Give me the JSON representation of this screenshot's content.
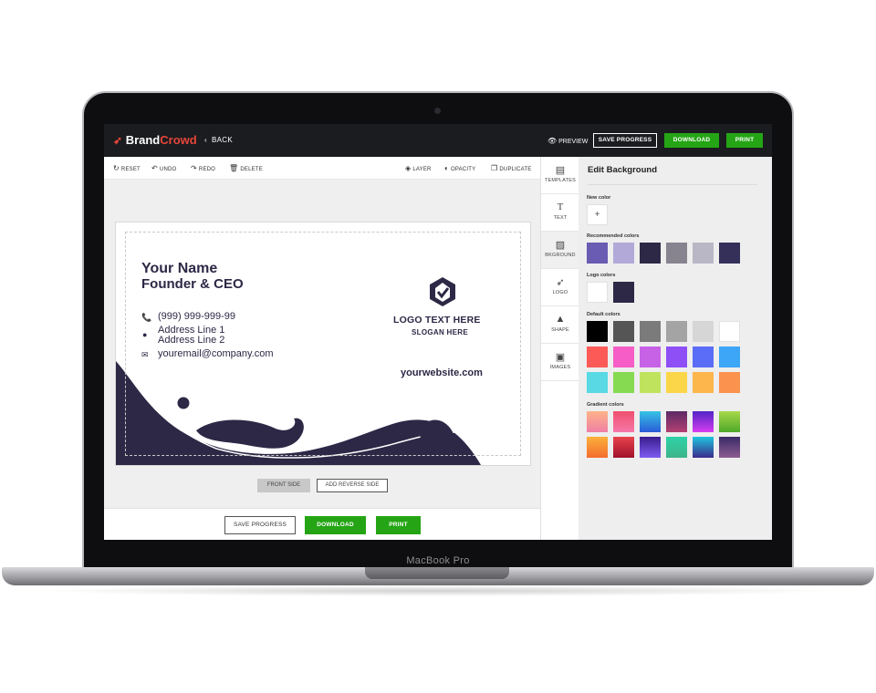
{
  "laptop": {
    "label": "MacBook Pro"
  },
  "app": {
    "brand": {
      "part1": "Brand",
      "part2": "Crowd"
    },
    "back_label": "BACK",
    "preview_label": "PREVIEW",
    "save_progress": "SAVE PROGRESS",
    "download": "DOWNLOAD",
    "print": "PRINT"
  },
  "toolbar": {
    "reset": "RESET",
    "undo": "UNDO",
    "redo": "REDO",
    "delete": "DELETE",
    "layer": "LAYER",
    "opacity": "OPACITY",
    "duplicate": "DUPLICATE"
  },
  "card": {
    "name": "Your Name",
    "title": "Founder & CEO",
    "phone": "(999) 999-999-99",
    "address1": "Address Line 1",
    "address2": "Address Line 2",
    "email": "youremail@company.com",
    "logo_text": "LOGO TEXT HERE",
    "slogan": "SLOGAN HERE",
    "website": "yourwebsite.com",
    "accent": "#2d2846"
  },
  "sides": {
    "front": "FRONT SIDE",
    "reverse": "ADD REVERSE SIDE"
  },
  "bottom": {
    "save_progress": "SAVE PROGRESS",
    "download": "DOWNLOAD",
    "print": "PRINT"
  },
  "rail": {
    "templates": "TEMPLATES",
    "text": "TEXT",
    "background": "BKGROUND",
    "logo": "LOGO",
    "shape": "SHAPE",
    "images": "IMAGES"
  },
  "panel": {
    "title": "Edit Background",
    "new_color": "New color",
    "recommended": "Recommended colors",
    "logo_colors": "Logo colors",
    "default_colors": "Default colors",
    "gradient_colors": "Gradient colors",
    "recommended_swatches": [
      "#6a5bb3",
      "#b2a9d8",
      "#2d2846",
      "#87848f",
      "#b9b7c6",
      "#34305a"
    ],
    "logo_swatches": [
      "#ffffff",
      "#2d2846"
    ],
    "default_swatches": [
      "#000000",
      "#555555",
      "#7b7b7b",
      "#a4a4a4",
      "#d6d6d6",
      "#ffffff",
      "#fb5a57",
      "#f65dc6",
      "#c762e6",
      "#8e4ff6",
      "#5b6df6",
      "#3ea6f7",
      "#58d9e3",
      "#85da51",
      "#c0e35e",
      "#fcd649",
      "#fcb64b",
      "#fb924e"
    ],
    "gradient_swatches": [
      [
        "#fdb288",
        "#f07fa5"
      ],
      [
        "#f04f6f",
        "#f678a9"
      ],
      [
        "#36c4e4",
        "#2a5bd8"
      ],
      [
        "#5c2a66",
        "#b34072"
      ],
      [
        "#5225c7",
        "#d63df0"
      ],
      [
        "#a7d84a",
        "#4fa829"
      ],
      [
        "#fbb03b",
        "#f46b2e"
      ],
      [
        "#e8434c",
        "#a0122c"
      ],
      [
        "#3a1c8c",
        "#7e5cf1"
      ],
      [
        "#2ed2a8",
        "#3db489"
      ],
      [
        "#1ec5de",
        "#3a2b8c"
      ],
      [
        "#3a2a66",
        "#8c5d91"
      ]
    ]
  }
}
